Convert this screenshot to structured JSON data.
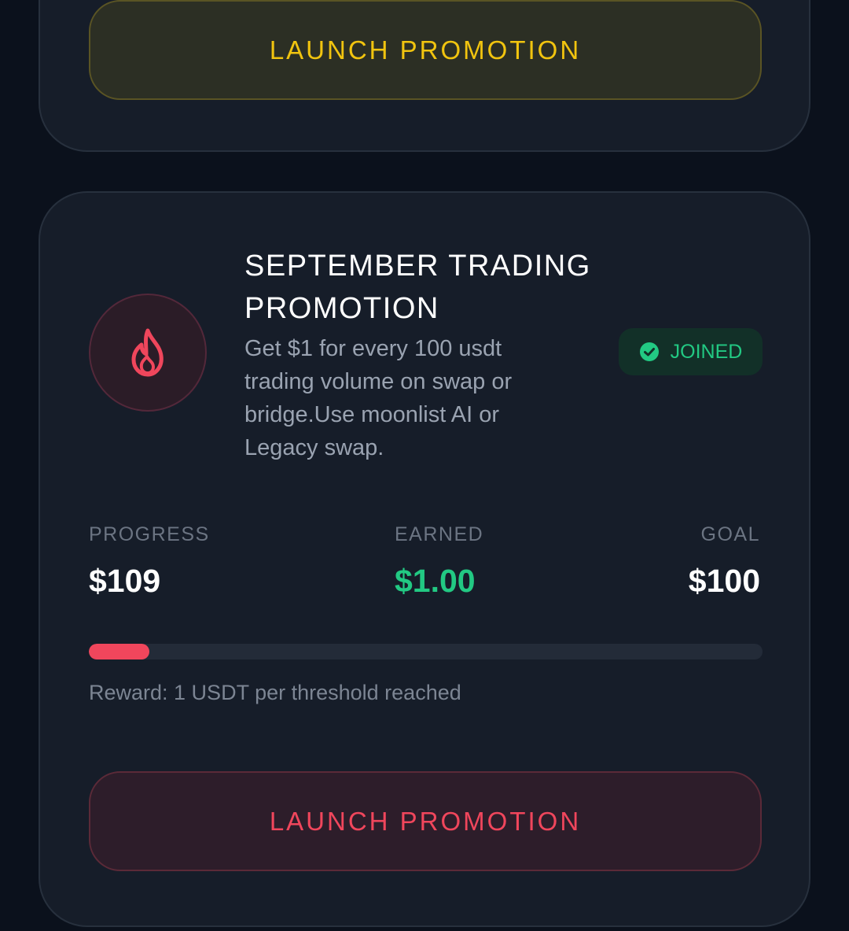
{
  "top_card": {
    "button_label": "LAUNCH PROMOTION"
  },
  "promotion": {
    "title": "SEPTEMBER TRADING PROMOTION",
    "description": "Get $1 for every 100 usdt trading volume on swap or bridge.Use moonlist AI or Legacy swap.",
    "icon": "flame-icon",
    "badge_label": "JOINED",
    "stats": {
      "progress_label": "PROGRESS",
      "progress_value": "$109",
      "earned_label": "EARNED",
      "earned_value": "$1.00",
      "goal_label": "GOAL",
      "goal_value": "$100"
    },
    "progress_fraction": 0.09,
    "reward_text": "Reward: 1 USDT per threshold reached",
    "button_label": "LAUNCH PROMOTION"
  },
  "colors": {
    "background": "#0b111c",
    "card": "#161d29",
    "accent_red": "#f0465c",
    "accent_yellow": "#f1c40f",
    "success_green": "#22c983"
  }
}
